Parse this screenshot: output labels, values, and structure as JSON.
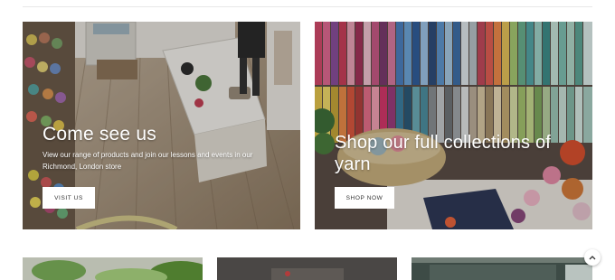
{
  "cards": [
    {
      "title": "Come see us",
      "description": "View our range of products and join our lessons and events in our Richmond, London store",
      "button_label": "VISIT US"
    },
    {
      "title": "Shop our full collections of yarn",
      "button_label": "SHOP NOW"
    }
  ],
  "scroll_top": {
    "icon": "chevron-up-icon"
  }
}
